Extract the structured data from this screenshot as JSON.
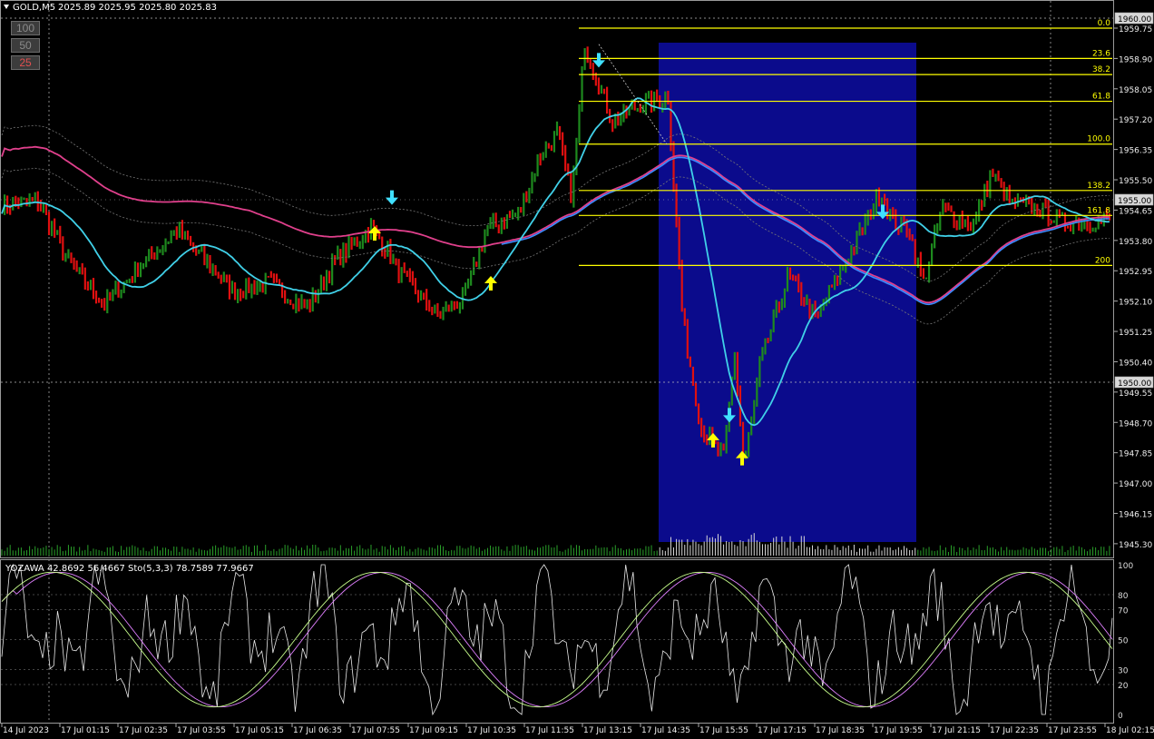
{
  "header": {
    "symbol": "GOLD,M5",
    "ohlc": "2025.89 2025.95 2025.80 2025.83"
  },
  "zoom_buttons": [
    {
      "label": "100",
      "color": "#8a8a8a"
    },
    {
      "label": "50",
      "color": "#8a8a8a"
    },
    {
      "label": "25",
      "color": "#e05050"
    }
  ],
  "price_axis": {
    "labels": [
      "1959.75",
      "1958.90",
      "1958.05",
      "1957.20",
      "1956.35",
      "1955.50",
      "1954.65",
      "1953.80",
      "1952.95",
      "1952.10",
      "1951.25",
      "1950.40",
      "1949.55",
      "1948.70",
      "1947.85",
      "1947.00",
      "1946.15",
      "1945.30"
    ],
    "top_box": "1960.00",
    "mid_box": "1950.00",
    "current_price": "1955.00"
  },
  "fibonacci": {
    "levels": [
      {
        "label": "0.0",
        "price": 1959.75
      },
      {
        "label": "23.6",
        "price": 1958.9
      },
      {
        "label": "38.2",
        "price": 1958.45
      },
      {
        "label": "61.8",
        "price": 1957.7
      },
      {
        "label": "100.0",
        "price": 1956.5
      },
      {
        "label": "138.2",
        "price": 1955.2
      },
      {
        "label": "161.8",
        "price": 1954.5
      },
      {
        "label": "200",
        "price": 1953.1
      }
    ],
    "color": "#ffff00"
  },
  "indicator": {
    "title": "YOZAWA 42.8692 56.4667  Sto(5,3,3) 78.7589 77.9667",
    "levels": [
      "100",
      "80",
      "70",
      "50",
      "30",
      "20",
      "0"
    ]
  },
  "time_axis": {
    "labels": [
      "14 Jul 2023",
      "17 Jul 01:15",
      "17 Jul 02:35",
      "17 Jul 03:55",
      "17 Jul 05:15",
      "17 Jul 06:35",
      "17 Jul 07:55",
      "17 Jul 09:15",
      "17 Jul 10:35",
      "17 Jul 11:55",
      "17 Jul 13:15",
      "17 Jul 14:35",
      "17 Jul 15:55",
      "17 Jul 17:15",
      "17 Jul 18:35",
      "17 Jul 19:55",
      "17 Jul 21:15",
      "17 Jul 22:35",
      "17 Jul 23:55",
      "18 Jul 02:15"
    ]
  },
  "colors": {
    "bull": "#1e8a1e",
    "bear": "#e01010",
    "highlight_zone": "#0b0b8c",
    "ma_pink": "#e0408c",
    "ma_cyan": "#40d0e8",
    "ma_blue": "#3c8cff",
    "arrow_up": "#ffff00",
    "arrow_down": "#40e0ff",
    "stoch_main": "#c8ff8c",
    "stoch_signal": "#e080ff",
    "yozawa": "#e8e8e8"
  },
  "signals": [
    {
      "type": "up",
      "bar": "17 Jul 07:55",
      "price": 1954.0
    },
    {
      "type": "down",
      "bar": "17 Jul 07:55",
      "price": 1955.0
    },
    {
      "type": "up",
      "bar": "17 Jul 10:35",
      "price": 1952.6
    },
    {
      "type": "down",
      "bar": "17 Jul 13:15",
      "price": 1958.85
    },
    {
      "type": "up",
      "bar": "17 Jul 15:55",
      "price": 1948.2
    },
    {
      "type": "down",
      "bar": "17 Jul 15:55",
      "price": 1948.9
    },
    {
      "type": "up",
      "bar": "17 Jul 15:55",
      "price": 1947.7
    },
    {
      "type": "down",
      "bar": "17 Jul 19:55",
      "price": 1954.6
    }
  ]
}
